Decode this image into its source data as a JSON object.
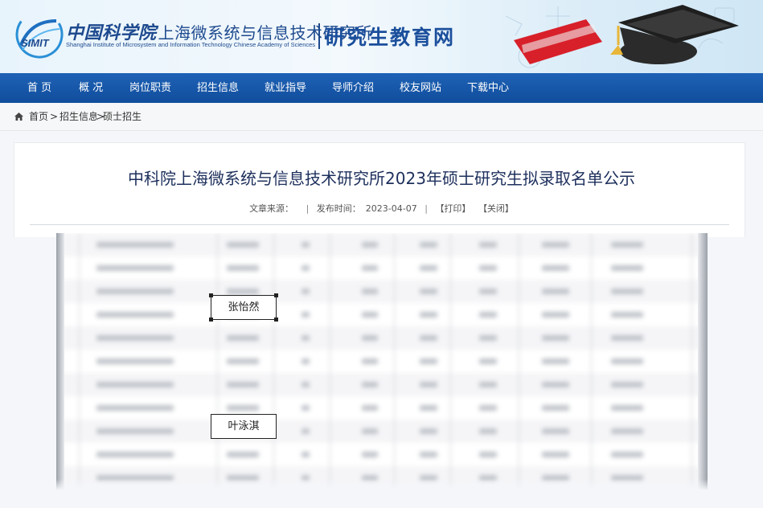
{
  "header": {
    "logo_text": "SIMIT",
    "institute_cn_prefix": "中国科学院",
    "institute_cn": "上海微系统与信息技术研究所",
    "institute_en": "Shanghai Institute of Microsystem and Information Technology Chinese Academy of Sciences",
    "site_name": "研究生教育网"
  },
  "nav": {
    "items": [
      "首 页",
      "概 况",
      "岗位职责",
      "招生信息",
      "就业指导",
      "导师介绍",
      "校友网站",
      "下载中心"
    ]
  },
  "breadcrumb": {
    "home": "首页",
    "sep1": ">",
    "section": "招生信息",
    "sep2": ">",
    "current": "硕士招生"
  },
  "article": {
    "title": "中科院上海微系统与信息技术研究所2023年硕士研究生拟录取名单公示",
    "source_label": "文章来源：",
    "source_value": "",
    "sep": "|",
    "publish_label": "发布时间：",
    "publish_date": "2023-04-07",
    "print_label": "【打印】",
    "close_label": "【关闭】"
  },
  "table": {
    "highlighted_names": [
      "张怡然",
      "叶泳淇"
    ]
  },
  "colors": {
    "nav_bg": "#1a5aaa",
    "title_color": "#1d2f5c",
    "brand_blue": "#1e4a8e"
  },
  "icons": {
    "home": "home-icon",
    "logo": "simit-logo",
    "decoration": "graduation-cap-illustration"
  }
}
